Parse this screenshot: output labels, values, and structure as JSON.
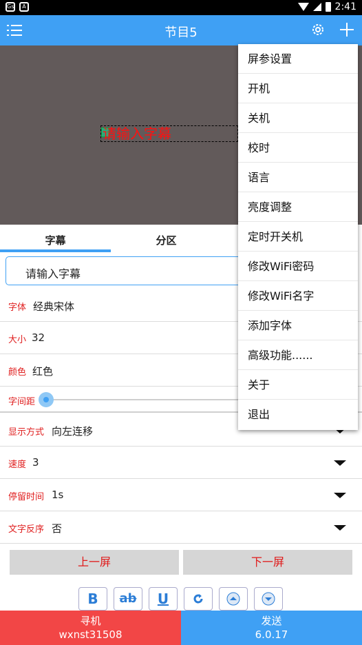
{
  "status": {
    "time": "2:41"
  },
  "appbar": {
    "title": "节目5"
  },
  "preview": {
    "caption_text": "请输入字幕"
  },
  "tabs": [
    {
      "label": "字幕"
    },
    {
      "label": "分区"
    },
    {
      "label": ""
    }
  ],
  "caption_input": {
    "value": "请输入字幕"
  },
  "settings": {
    "font": {
      "label": "字体",
      "value": "经典宋体"
    },
    "size": {
      "label": "大小",
      "value": "32"
    },
    "color": {
      "label": "颜色",
      "value": "红色"
    },
    "spacing": {
      "label": "字间距",
      "level": 0
    },
    "display_mode": {
      "label": "显示方式",
      "value": "向左连移"
    },
    "speed": {
      "label": "速度",
      "value": "3"
    },
    "stay_time": {
      "label": "停留时间",
      "value": "1s"
    },
    "reverse": {
      "label": "文字反序",
      "value": "否"
    }
  },
  "screen_nav": {
    "prev": "上一屏",
    "next": "下一屏"
  },
  "format_tools": [
    {
      "icon": "bold-icon",
      "glyph": "B"
    },
    {
      "icon": "strikethrough-icon",
      "glyph": "ab"
    },
    {
      "icon": "underline-icon",
      "glyph": "U"
    },
    {
      "icon": "rotate-icon"
    },
    {
      "icon": "move-up-icon"
    },
    {
      "icon": "move-down-icon"
    }
  ],
  "bottom": {
    "search_label": "寻机",
    "device_id": "wxnst31508",
    "send_label": "发送",
    "version": "6.0.17"
  },
  "dropdown_menu": [
    {
      "label": "屏参设置"
    },
    {
      "label": "开机"
    },
    {
      "label": "关机"
    },
    {
      "label": "校时"
    },
    {
      "label": "语言"
    },
    {
      "label": "亮度调整"
    },
    {
      "label": "定时开关机"
    },
    {
      "label": "修改WiFi密码"
    },
    {
      "label": "修改WiFi名字"
    },
    {
      "label": "添加字体"
    },
    {
      "label": "高级功能......"
    },
    {
      "label": "关于"
    },
    {
      "label": "退出"
    }
  ],
  "colors": {
    "accent": "#3fa0f4",
    "danger": "#f24646",
    "label_red": "#e02020"
  }
}
